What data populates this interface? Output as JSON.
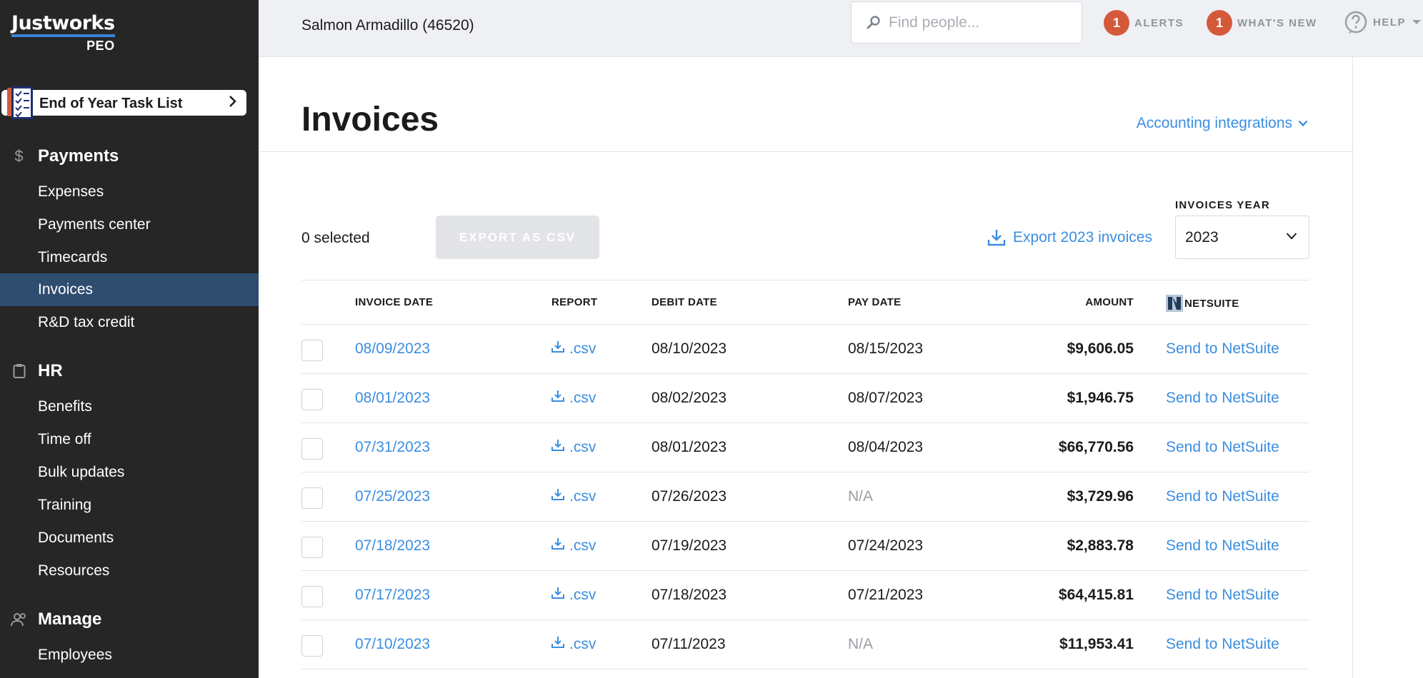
{
  "brand": {
    "name": "Justworks",
    "sub": "PEO"
  },
  "task_list": {
    "label": "End of Year Task List"
  },
  "sidebar": {
    "sections": [
      {
        "label": "Payments",
        "icon": "dollar-icon",
        "items": [
          "Expenses",
          "Payments center",
          "Timecards",
          "Invoices",
          "R&D tax credit"
        ]
      },
      {
        "label": "HR",
        "icon": "clipboard-icon",
        "items": [
          "Benefits",
          "Time off",
          "Bulk updates",
          "Training",
          "Documents",
          "Resources"
        ]
      },
      {
        "label": "Manage",
        "icon": "people-icon",
        "items": [
          "Employees"
        ]
      }
    ],
    "active_item": "Invoices"
  },
  "topbar": {
    "company": "Salmon Armadillo (46520)",
    "search_placeholder": "Find people...",
    "alerts": {
      "count": "1",
      "label": "ALERTS"
    },
    "whats_new": {
      "count": "1",
      "label": "WHAT'S NEW"
    },
    "help": {
      "label": "HELP"
    }
  },
  "page": {
    "title": "Invoices",
    "accounting_link": "Accounting integrations",
    "selected": "0 selected",
    "export_csv": "EXPORT AS CSV",
    "export_year": "Export 2023 invoices",
    "year_label": "INVOICES YEAR",
    "year_value": "2023"
  },
  "table": {
    "headers": {
      "invoice_date": "INVOICE DATE",
      "report": "REPORT",
      "debit_date": "DEBIT DATE",
      "pay_date": "PAY DATE",
      "amount": "AMOUNT",
      "netsuite": "NETSUITE"
    },
    "rows": [
      {
        "invoice_date": "08/09/2023",
        "report": ".csv",
        "debit_date": "08/10/2023",
        "pay_date": "08/15/2023",
        "amount": "$9,606.05",
        "action": "Send to NetSuite"
      },
      {
        "invoice_date": "08/01/2023",
        "report": ".csv",
        "debit_date": "08/02/2023",
        "pay_date": "08/07/2023",
        "amount": "$1,946.75",
        "action": "Send to NetSuite"
      },
      {
        "invoice_date": "07/31/2023",
        "report": ".csv",
        "debit_date": "08/01/2023",
        "pay_date": "08/04/2023",
        "amount": "$66,770.56",
        "action": "Send to NetSuite"
      },
      {
        "invoice_date": "07/25/2023",
        "report": ".csv",
        "debit_date": "07/26/2023",
        "pay_date": "N/A",
        "amount": "$3,729.96",
        "action": "Send to NetSuite"
      },
      {
        "invoice_date": "07/18/2023",
        "report": ".csv",
        "debit_date": "07/19/2023",
        "pay_date": "07/24/2023",
        "amount": "$2,883.78",
        "action": "Send to NetSuite"
      },
      {
        "invoice_date": "07/17/2023",
        "report": ".csv",
        "debit_date": "07/18/2023",
        "pay_date": "07/21/2023",
        "amount": "$64,415.81",
        "action": "Send to NetSuite"
      },
      {
        "invoice_date": "07/10/2023",
        "report": ".csv",
        "debit_date": "07/11/2023",
        "pay_date": "N/A",
        "amount": "$11,953.41",
        "action": "Send to NetSuite"
      }
    ]
  },
  "colors": {
    "sidebar_bg": "#262626",
    "active_item": "#2f4d6f",
    "link": "#3b8ee0",
    "badge": "#d4593a",
    "topbar_bg": "#eef0f3"
  }
}
